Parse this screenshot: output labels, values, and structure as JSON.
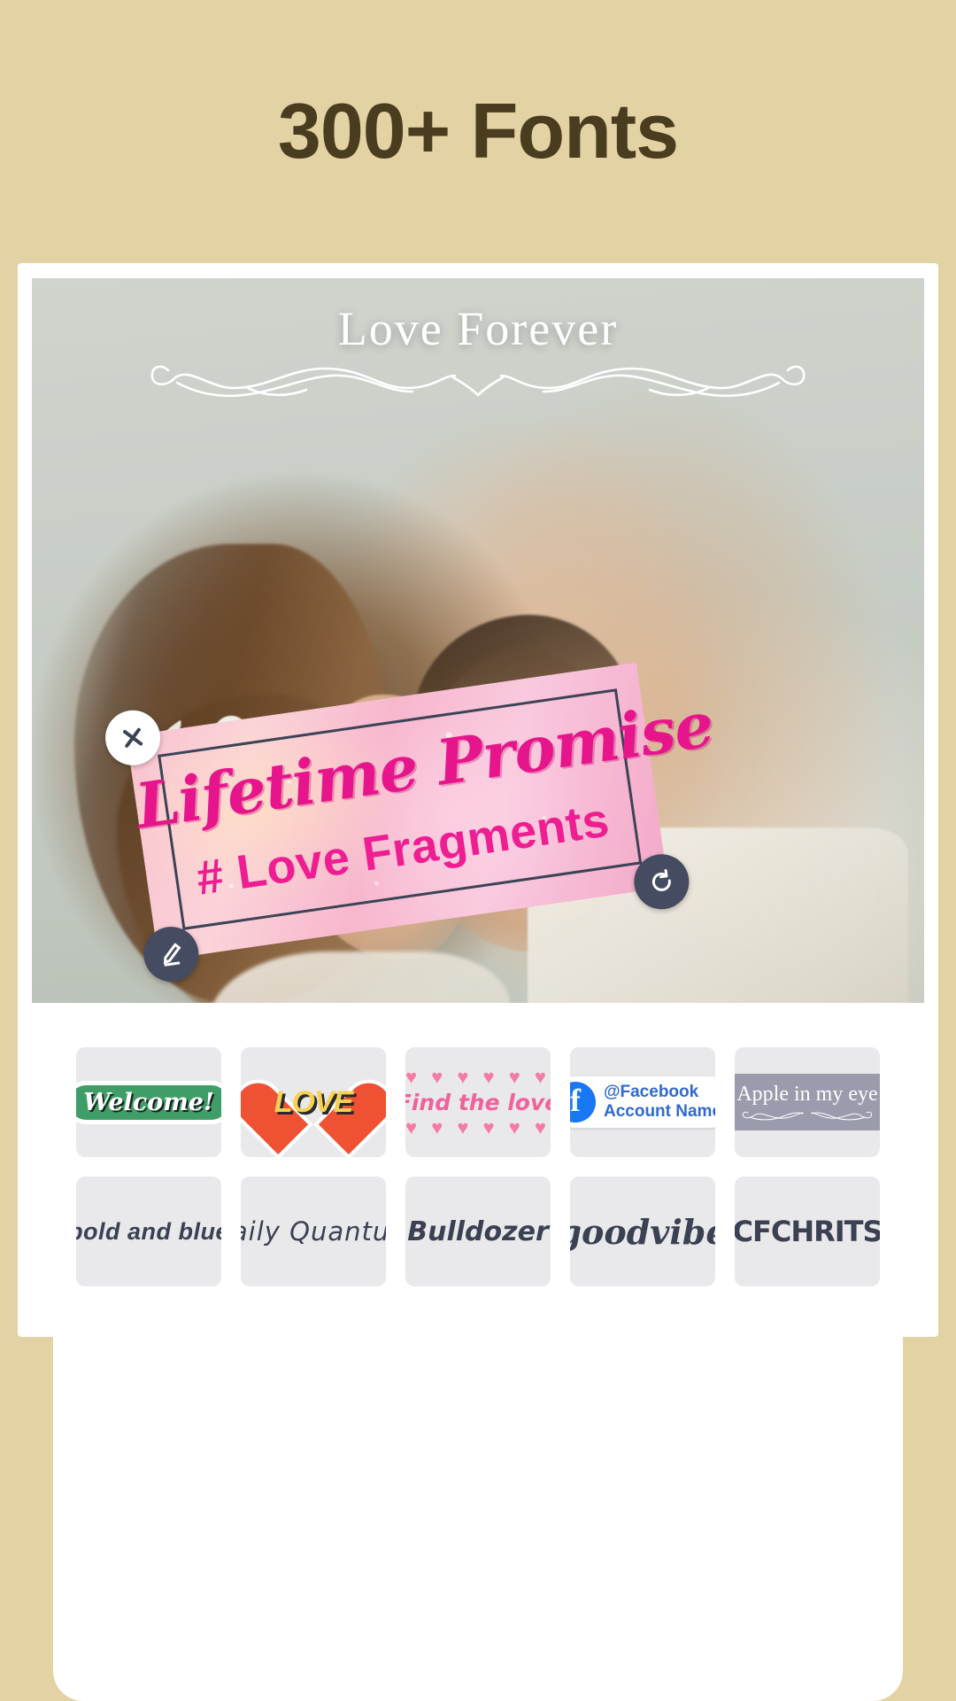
{
  "headline": {
    "text": "300+ Fonts"
  },
  "colors": {
    "background": "#e3d2a4",
    "headline_text": "#4a3c1e",
    "sticker_pink": "#ee1d92",
    "handle_dark": "#454b60",
    "facebook_blue": "#1877f2"
  },
  "editor": {
    "photo_overlay_title": "Love Forever",
    "sticker": {
      "script_text": "Lifetime Promise",
      "tag_text": "# Love Fragments",
      "handles": {
        "close": "✕",
        "edit": "✎",
        "rotate": "↻"
      }
    }
  },
  "font_panel": {
    "items": [
      {
        "kind": "welcome-sticker",
        "label": "Welcome!"
      },
      {
        "kind": "love-heart",
        "label": "LOVE"
      },
      {
        "kind": "find-the-love",
        "label": "Find the love",
        "hearts_top": "♥ ♥ ♥ ♥ ♥ ♥",
        "hearts_bottom": "♥ ♥ ♥ ♥ ♥ ♥"
      },
      {
        "kind": "facebook-tag",
        "label_line1": "@Facebook",
        "label_line2": "Account Name",
        "mark": "f"
      },
      {
        "kind": "apple-banner",
        "label": "Apple in my eye"
      },
      {
        "kind": "plain-font",
        "label": "bold and blue"
      },
      {
        "kind": "plain-font",
        "label": "Daily Quantum"
      },
      {
        "kind": "plain-font",
        "label": "Bulldozer"
      },
      {
        "kind": "plain-font",
        "label": "goodvibe"
      },
      {
        "kind": "plain-font",
        "label": "CFCHRITS"
      }
    ]
  }
}
